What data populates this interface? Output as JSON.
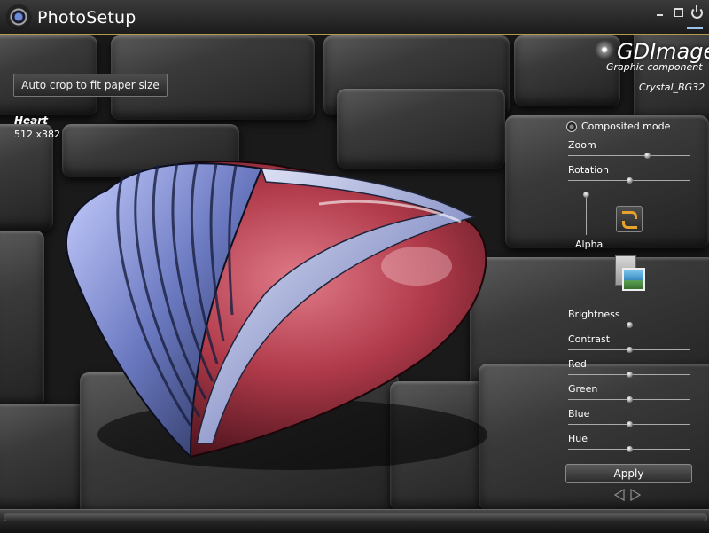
{
  "window": {
    "title": "PhotoSetup"
  },
  "toolbar": {
    "crop_label": "Auto crop to fit paper size"
  },
  "image_info": {
    "name": "Heart",
    "size": "512 x382"
  },
  "brand": {
    "title": "GDImage",
    "subtitle": "Graphic component",
    "skin": "Crystal_BG32"
  },
  "panel": {
    "composited_mode": "Composited mode",
    "sliders": {
      "zoom": {
        "label": "Zoom",
        "value": 0.65
      },
      "rotation": {
        "label": "Rotation",
        "value": 0.5
      },
      "alpha": {
        "label": "Alpha",
        "value": 0.0
      },
      "brightness": {
        "label": "Brightness",
        "value": 0.5
      },
      "contrast": {
        "label": "Contrast",
        "value": 0.5
      },
      "red": {
        "label": "Red",
        "value": 0.5
      },
      "green": {
        "label": "Green",
        "value": 0.5
      },
      "blue": {
        "label": "Blue",
        "value": 0.5
      },
      "hue": {
        "label": "Hue",
        "value": 0.5
      }
    },
    "apply_label": "Apply"
  },
  "icons": {
    "app": "camera-lens-icon",
    "minimize": "minimize-icon",
    "maximize": "maximize-icon",
    "power": "power-icon",
    "rotate": "rotate-icon",
    "open": "open-image-icon",
    "prev": "previous-arrow-icon",
    "next": "next-arrow-icon"
  },
  "colors": {
    "accent_gold": "#b89a4a",
    "heart_red": "#b03a4a",
    "heart_band": "#8a9ad8",
    "rotate_orange": "#e6a22a",
    "power_bar": "#9bc2e8"
  }
}
